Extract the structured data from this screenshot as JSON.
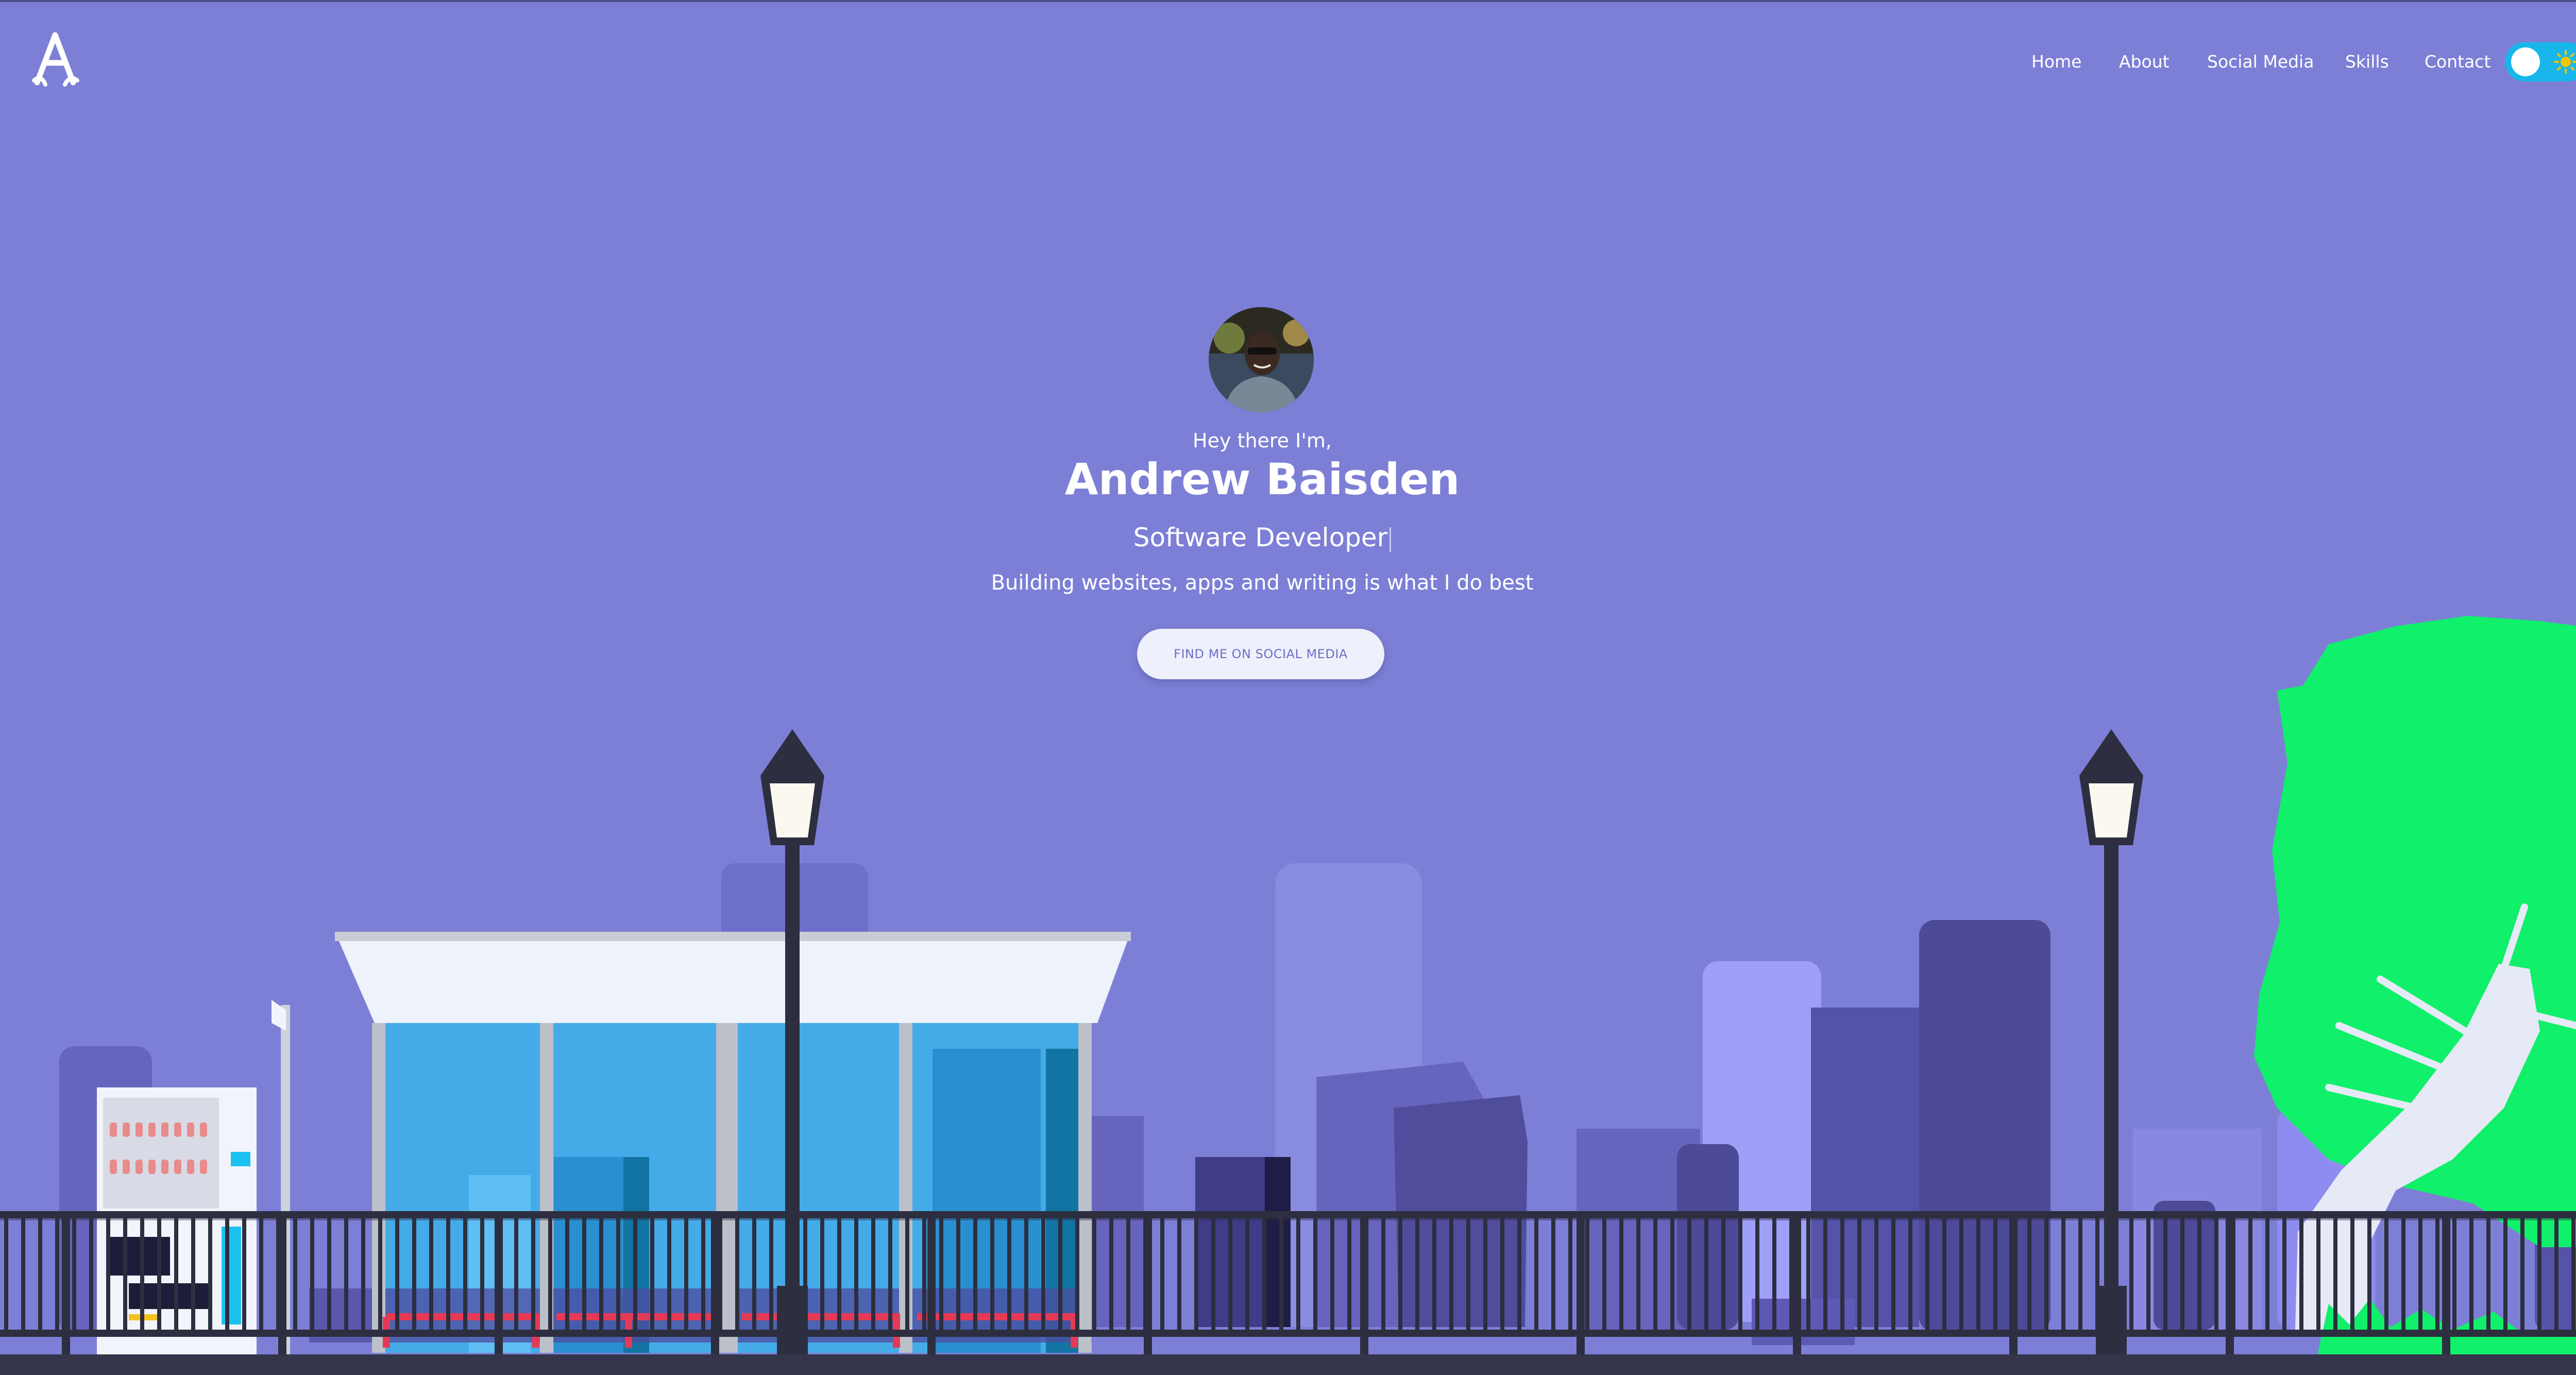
{
  "header": {
    "logo_icon": "stylized-a-logo",
    "nav": [
      "Home",
      "About",
      "Social Media",
      "Skills",
      "Contact"
    ],
    "theme_toggle_icon": "sun-icon"
  },
  "hero": {
    "greeting": "Hey there I'm,",
    "name": "Andrew Baisden",
    "role": "Software Developer",
    "tagline": "Building websites, apps and writing is what I do best",
    "cta_label": "FIND ME ON SOCIAL MEDIA"
  },
  "colors": {
    "background": "#7d7fd6",
    "toggle": "#18b6ea",
    "sun": "#f5c400",
    "tree": "#10f06a",
    "glass": "#45abe8",
    "fence": "#2d2e3f"
  }
}
